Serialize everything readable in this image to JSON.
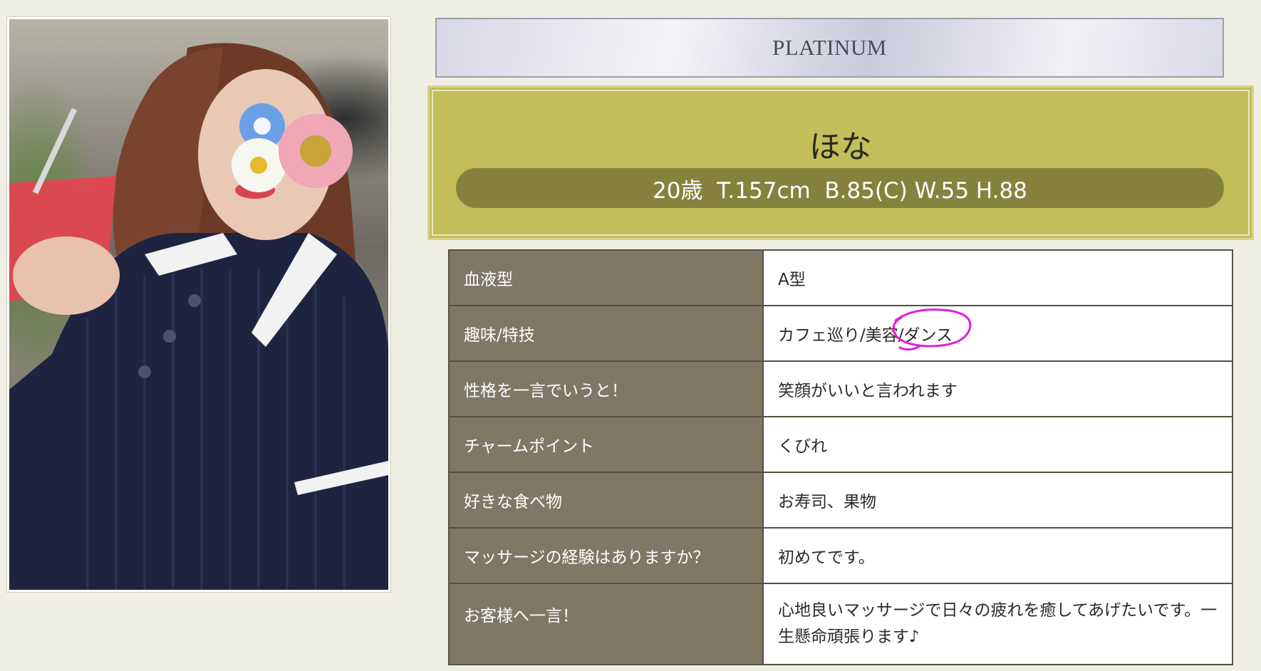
{
  "rank": {
    "label": "PLATINUM"
  },
  "profile": {
    "name": "ほな",
    "stats": "20歳  T.157cm  B.85(C) W.55 H.88"
  },
  "details": [
    {
      "label": "血液型",
      "value": "A型"
    },
    {
      "label": "趣味/特技",
      "value": "カフェ巡り/美容/ダンス"
    },
    {
      "label": "性格を一言でいうと！",
      "value": "笑顔がいいと言われます"
    },
    {
      "label": "チャームポイント",
      "value": "くびれ"
    },
    {
      "label": "好きな食べ物",
      "value": "お寿司、果物"
    },
    {
      "label": "マッサージの経験はありますか？",
      "value": "初めてです。"
    },
    {
      "label": "お客様へ一言！",
      "value": "心地良いマッサージで日々の疲れを癒してあげたいです。一生懸命頑張ります♪"
    }
  ],
  "colors": {
    "rank_banner": "#d7d8e4",
    "name_box": "#c3be5a",
    "stats_pill": "#86823e",
    "label_cell": "#7e7865",
    "annotation": "#e020d8"
  }
}
